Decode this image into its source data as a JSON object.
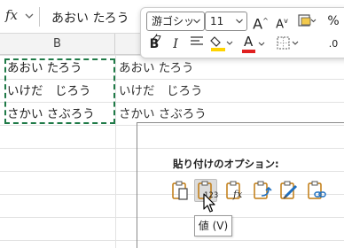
{
  "formula_bar": {
    "fx_label": "fx",
    "content": "あおい たろう"
  },
  "column_header": {
    "b": "B"
  },
  "source_cells": [
    "あおい たろう",
    "いけだ　じろう",
    "さかい さぶろう"
  ],
  "pasted_cells": [
    "あおい たろう",
    "いけだ　じろう",
    "さかい さぶろう"
  ],
  "mini_toolbar": {
    "font_name": "游ゴシック",
    "font_size": "11",
    "bold_label": "B",
    "italic_label": "I",
    "font_color_label": "A",
    "percent_label": "%",
    "grow_font_label": "A",
    "shrink_font_label": "A",
    "decimal_label": ".0"
  },
  "paste_options": {
    "title": "貼り付けのオプション:",
    "items": [
      {
        "name": "paste",
        "badge": ""
      },
      {
        "name": "values",
        "badge": "123"
      },
      {
        "name": "formulas",
        "badge": "fx"
      },
      {
        "name": "transpose",
        "badge": ""
      },
      {
        "name": "formatting",
        "badge": ""
      },
      {
        "name": "paste-link",
        "badge": ""
      }
    ]
  },
  "tooltip": "値 (V)",
  "colors": {
    "marquee": "#1f7a47",
    "fill_highlight": "#ffd400",
    "font_color": "#e02020",
    "paste_icon": "#c07a10",
    "icon_blue": "#1f6fbf"
  }
}
